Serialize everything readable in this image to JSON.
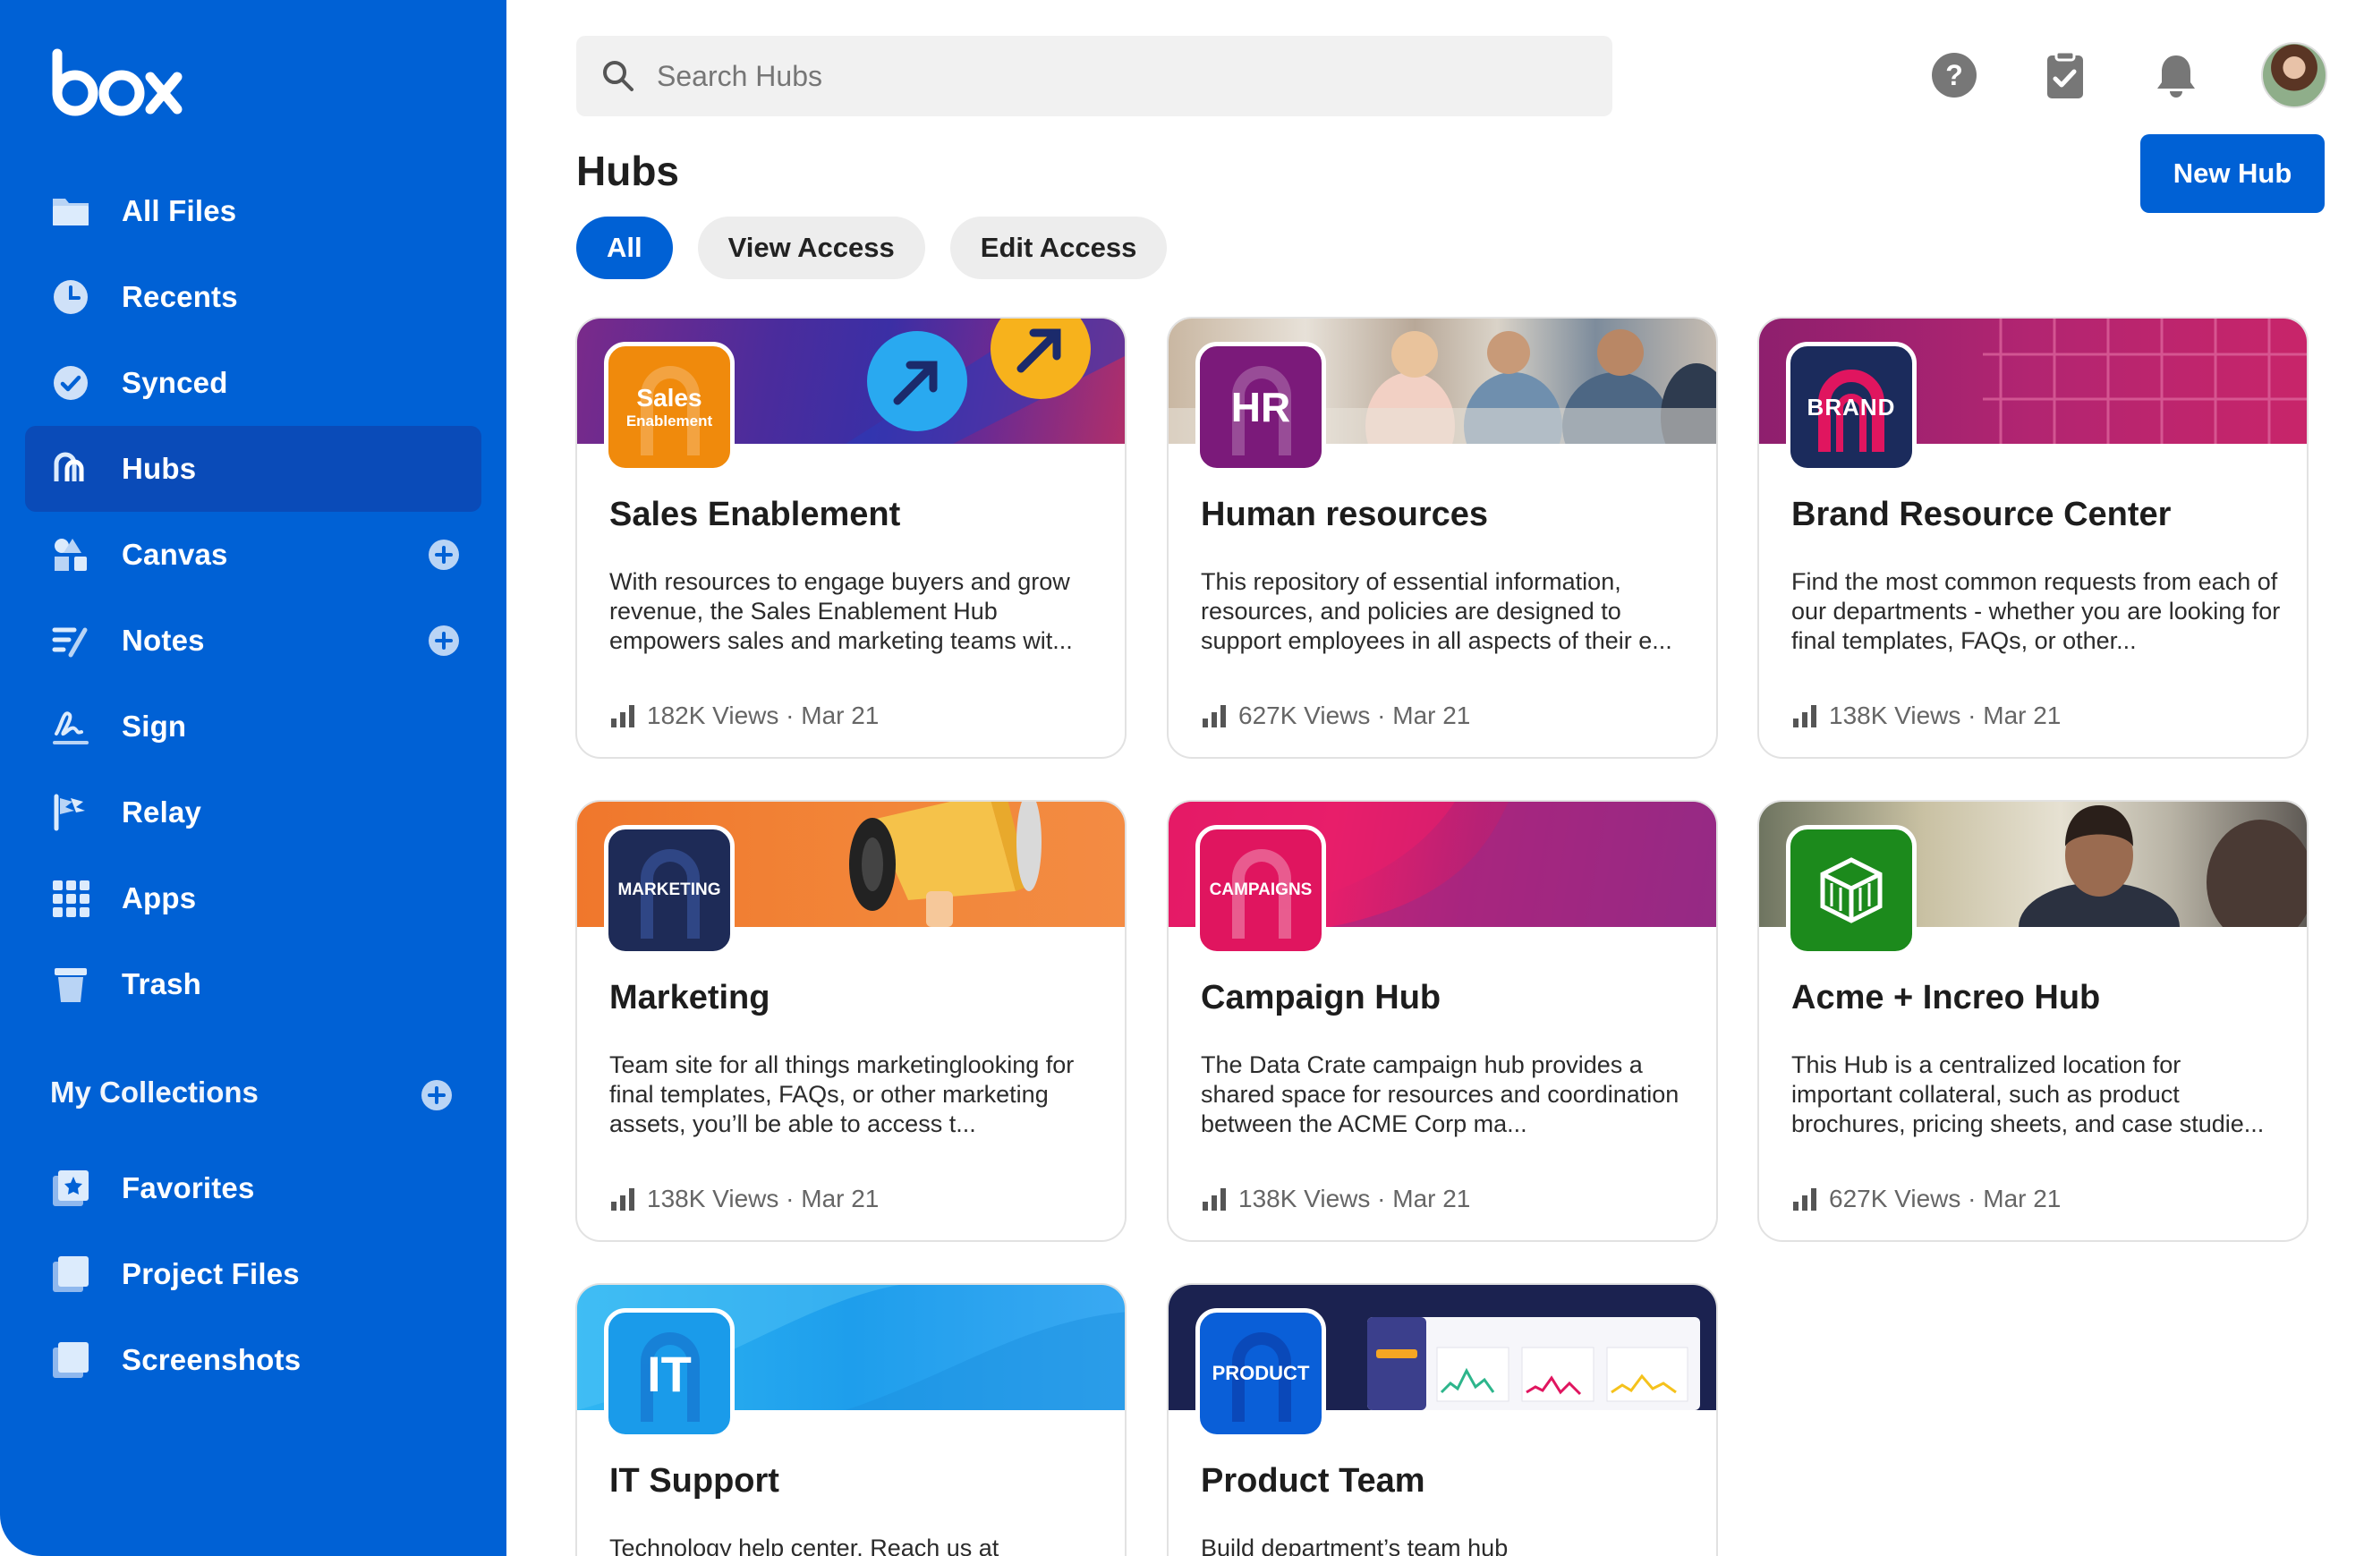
{
  "app": {
    "logo": "box"
  },
  "sidebar": {
    "items": [
      {
        "label": "All Files",
        "icon": "folder-icon"
      },
      {
        "label": "Recents",
        "icon": "clock-icon"
      },
      {
        "label": "Synced",
        "icon": "check-circle-icon"
      },
      {
        "label": "Hubs",
        "icon": "hubs-icon",
        "active": true
      },
      {
        "label": "Canvas",
        "icon": "canvas-icon",
        "add": true
      },
      {
        "label": "Notes",
        "icon": "notes-icon",
        "add": true
      },
      {
        "label": "Sign",
        "icon": "sign-icon"
      },
      {
        "label": "Relay",
        "icon": "relay-icon"
      },
      {
        "label": "Apps",
        "icon": "apps-grid-icon"
      },
      {
        "label": "Trash",
        "icon": "trash-icon"
      }
    ],
    "collections_title": "My Collections",
    "collections": [
      {
        "label": "Favorites",
        "icon": "favorites-icon"
      },
      {
        "label": "Project Files",
        "icon": "collection-icon"
      },
      {
        "label": "Screenshots",
        "icon": "collection-icon"
      }
    ]
  },
  "header": {
    "search_placeholder": "Search Hubs",
    "icons": [
      "help-icon",
      "tasks-icon",
      "bell-icon",
      "user-avatar"
    ]
  },
  "main": {
    "title": "Hubs",
    "new_button": "New Hub",
    "filters": [
      "All",
      "View Access",
      "Edit Access"
    ],
    "active_filter": "All",
    "cards": [
      {
        "title": "Sales Enablement",
        "badge_line1": "Sales",
        "badge_line2": "Enablement",
        "desc": "With resources to engage buyers and grow revenue, the Sales Enablement Hub empowers sales and marketing teams wit...",
        "meta": "182K Views · Mar 21"
      },
      {
        "title": "Human resources",
        "badge_line1": "HR",
        "badge_line2": "",
        "desc": "This repository of essential information, resources, and policies are designed to support employees in all aspects of their e...",
        "meta": "627K Views · Mar 21"
      },
      {
        "title": "Brand Resource Center",
        "badge_line1": "BRAND",
        "badge_line2": "",
        "desc": "Find the most common requests from each of our departments - whether you are looking for final templates, FAQs, or other...",
        "meta": "138K Views · Mar 21"
      },
      {
        "title": "Marketing",
        "badge_line1": "MARKETING",
        "badge_line2": "",
        "desc": "Team site for all things marketinglooking for final templates, FAQs, or other marketing assets, you’ll be able to access t...",
        "meta": "138K Views · Mar 21"
      },
      {
        "title": "Campaign Hub",
        "badge_line1": "CAMPAIGNS",
        "badge_line2": "",
        "desc": "The Data Crate campaign hub provides a shared space for resources and coordination between the ACME Corp ma...",
        "meta": "138K Views · Mar 21"
      },
      {
        "title": "Acme + Increo Hub",
        "badge_line1": "",
        "badge_line2": "",
        "desc": "This Hub is a centralized location for important collateral, such as product brochures, pricing sheets, and case studie...",
        "meta": "627K Views · Mar 21"
      },
      {
        "title": "IT Support",
        "badge_line1": "IT",
        "badge_line2": "",
        "desc": "Technology help center. Reach us at",
        "meta": ""
      },
      {
        "title": "Product Team",
        "badge_line1": "PRODUCT",
        "badge_line2": "",
        "desc": "Build department’s team hub",
        "meta": ""
      }
    ]
  },
  "colors": {
    "brand": "#0061D5",
    "sidebar_active": "#0A4BB8",
    "sales": "#F08A0C",
    "hr": "#7B1A7A",
    "brand_badge": "#1B2B5C",
    "marketing": "#1E2B57",
    "campaigns": "#E0155F",
    "acme": "#1C8A1C",
    "it": "#1A9BEA",
    "product": "#0A5FD8"
  }
}
